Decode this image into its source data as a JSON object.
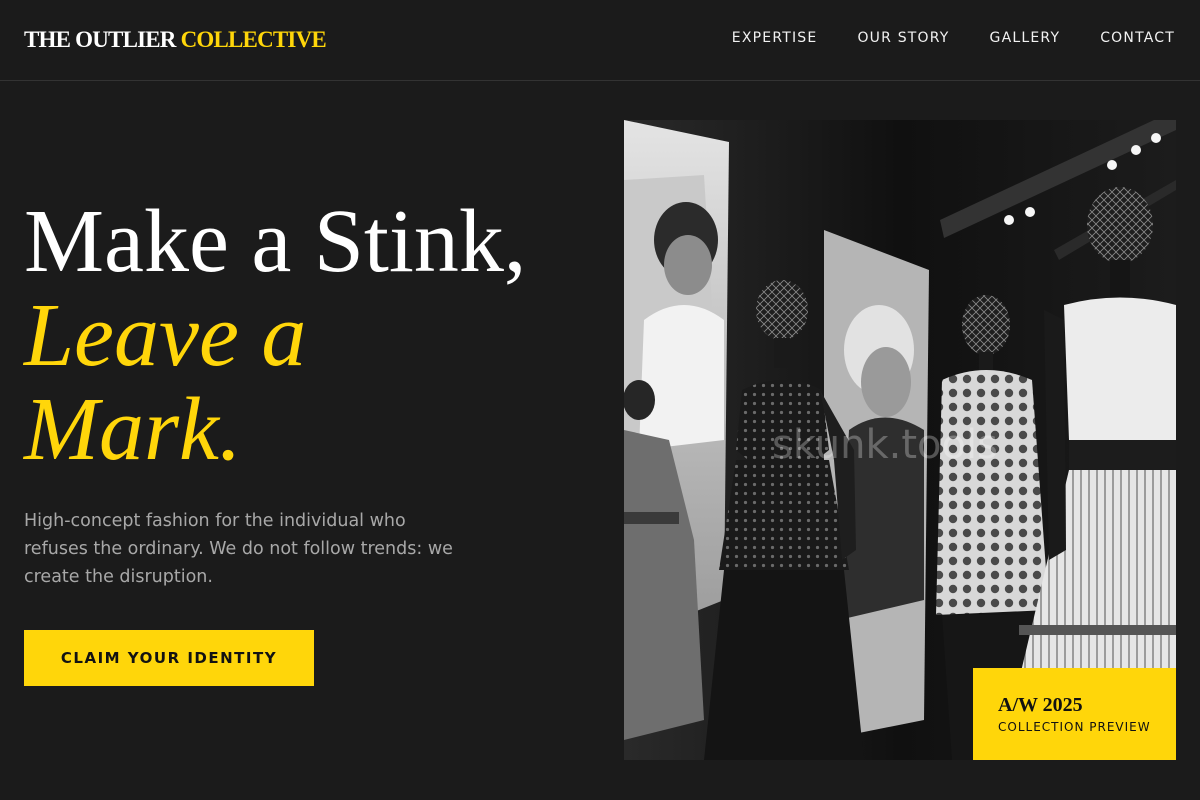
{
  "brand": {
    "name_part1": "THE OUTLIER",
    "name_part2": "COLLECTIVE"
  },
  "nav": {
    "items": [
      {
        "label": "EXPERTISE"
      },
      {
        "label": "OUR STORY"
      },
      {
        "label": "GALLERY"
      },
      {
        "label": "CONTACT"
      }
    ]
  },
  "hero": {
    "headline_line1": "Make a Stink,",
    "headline_line2": "Leave a",
    "headline_line3": "Mark.",
    "description": "High-concept fashion for the individual who refuses the ordinary. We do not follow trends: we create the disruption.",
    "cta_label": "CLAIM YOUR IDENTITY",
    "image_watermark": "skunk.tools"
  },
  "badge": {
    "season": "A/W 2025",
    "subtitle": "COLLECTION PREVIEW"
  },
  "colors": {
    "background": "#1b1b1b",
    "accent": "#ffd60a",
    "text": "#ffffff",
    "muted_text": "#a8a8a8"
  }
}
